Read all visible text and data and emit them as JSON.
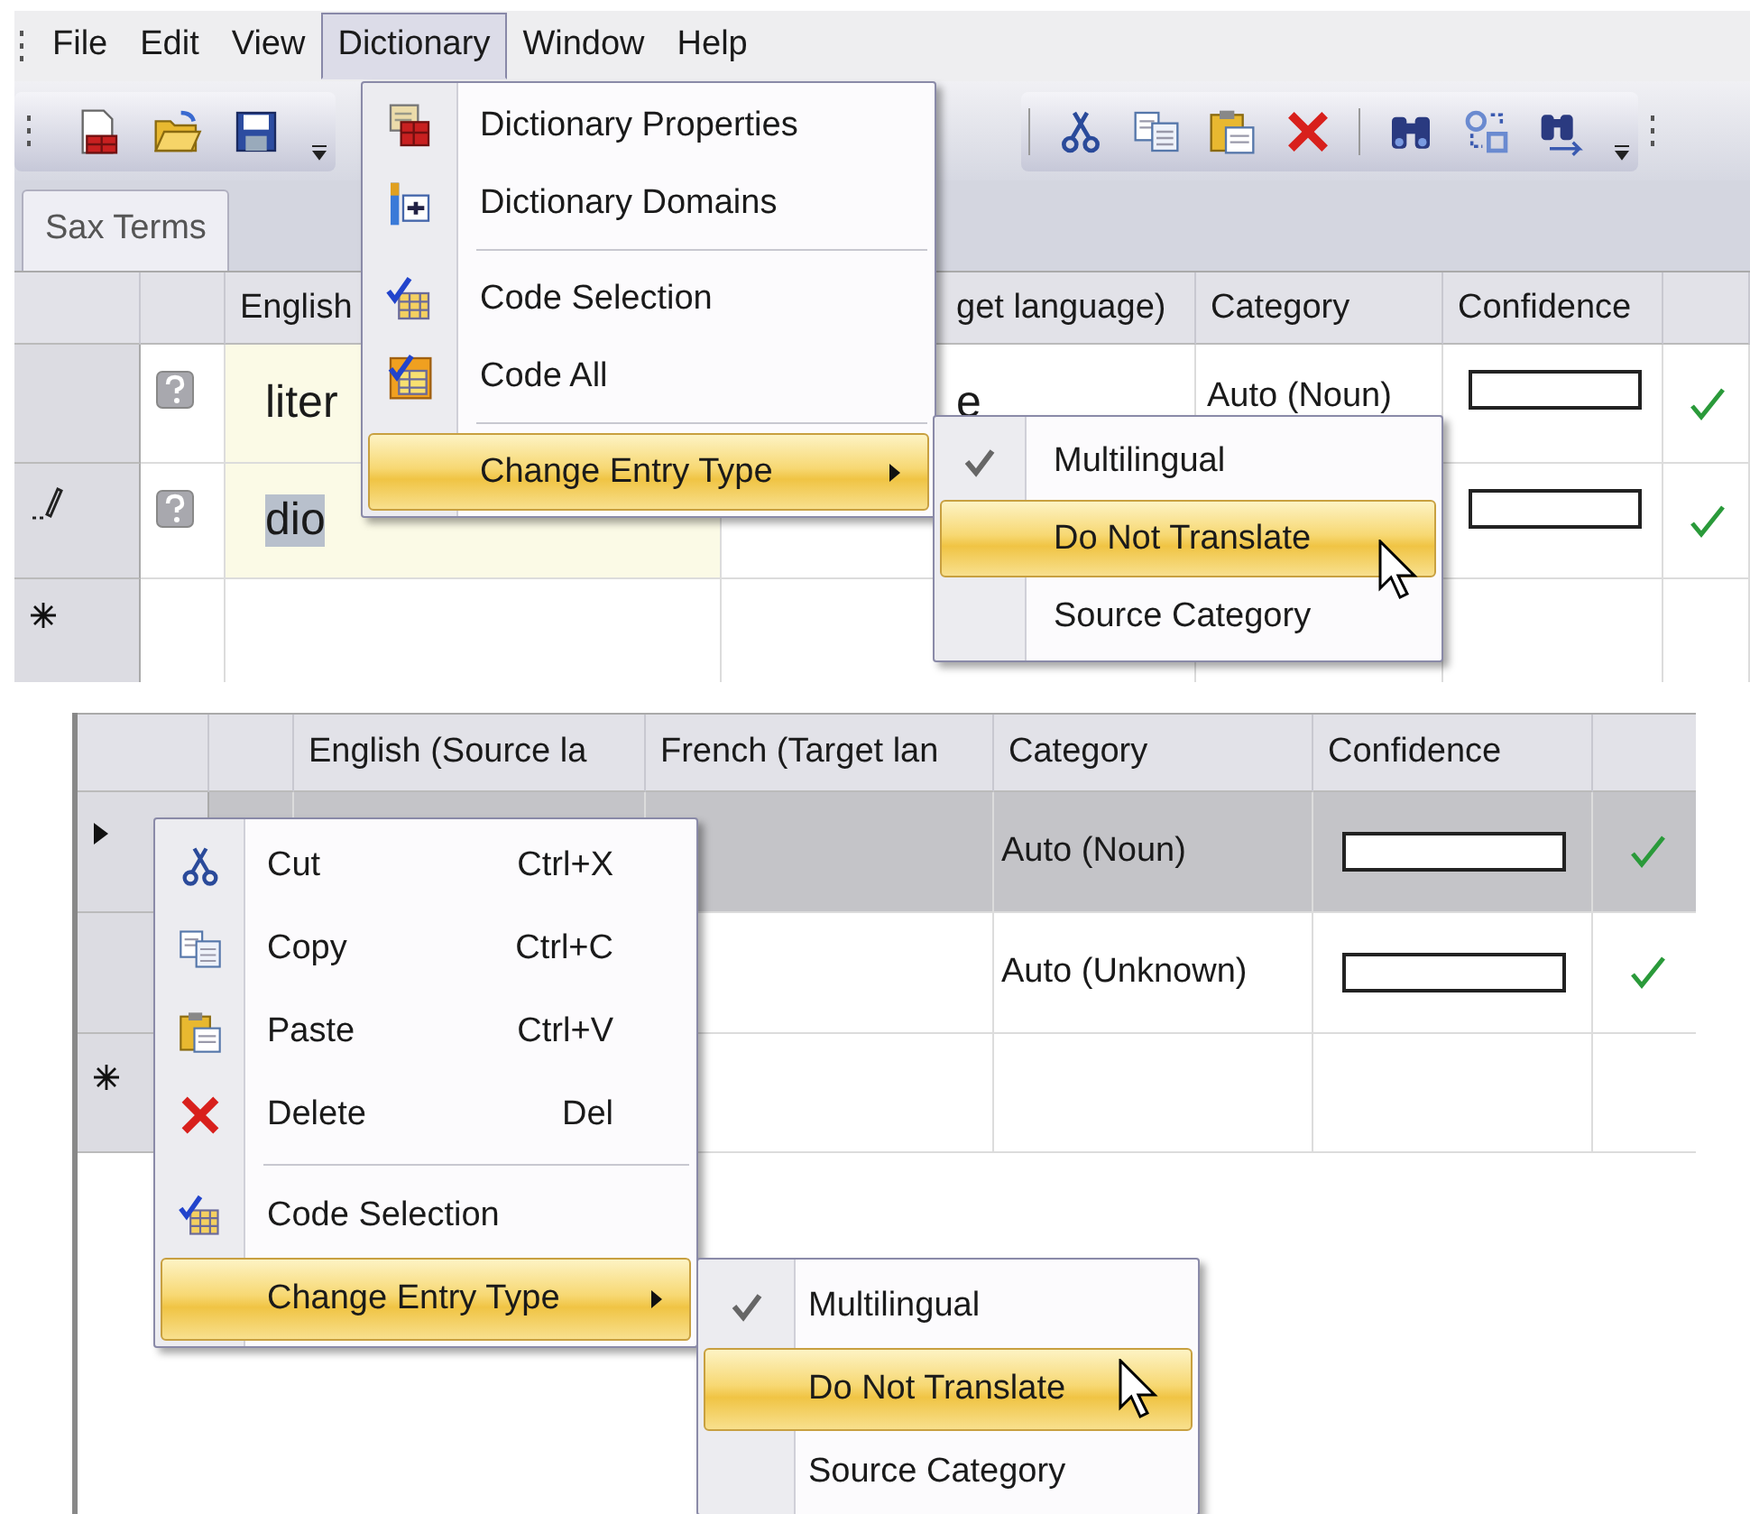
{
  "top_view": {
    "menu_bar": [
      {
        "label": "File",
        "selected": false
      },
      {
        "label": "Edit",
        "selected": false
      },
      {
        "label": "View",
        "selected": false
      },
      {
        "label": "Dictionary",
        "selected": true
      },
      {
        "label": "Window",
        "selected": false
      },
      {
        "label": "Help",
        "selected": false
      }
    ],
    "tabs": [
      {
        "label": "Sax Terms",
        "selected": true
      }
    ],
    "table": {
      "headers": {
        "source": "English",
        "target": "get language)",
        "category": "Category",
        "confidence": "Confidence"
      },
      "rows": [
        {
          "kind": "entry",
          "editing": false,
          "selected": false,
          "source": "liter",
          "source_selected": false,
          "target": "e",
          "category": "Auto (Noun)",
          "level": 0,
          "approved": true
        },
        {
          "kind": "entry",
          "editing": true,
          "selected": false,
          "source": "dio",
          "source_selected": true,
          "level": 0,
          "approved": true
        },
        {
          "kind": "new",
          "editing": false,
          "selected": false
        }
      ]
    },
    "dropdown_menu": {
      "items": [
        {
          "kind": "command",
          "label": "Dictionary Properties",
          "highlighted": false
        },
        {
          "kind": "command",
          "label": "Dictionary Domains",
          "highlighted": false
        },
        {
          "kind": "separator"
        },
        {
          "kind": "command",
          "label": "Code Selection",
          "highlighted": false
        },
        {
          "kind": "command",
          "label": "Code All",
          "highlighted": false
        },
        {
          "kind": "separator"
        },
        {
          "kind": "submenu",
          "label": "Change Entry Type",
          "highlighted": true
        }
      ]
    },
    "submenu": {
      "items": [
        {
          "label": "Multilingual",
          "checked": true,
          "highlighted": false
        },
        {
          "label": "Do Not Translate",
          "checked": false,
          "highlighted": true
        },
        {
          "label": "Source Category",
          "checked": false,
          "highlighted": false
        }
      ]
    }
  },
  "bottom_view": {
    "table": {
      "headers": {
        "source": "English (Source la",
        "target": "French (Target lan",
        "category": "Category",
        "confidence": "Confidence"
      },
      "rows": [
        {
          "kind": "entry",
          "editing": false,
          "selected": true,
          "category": "Auto (Noun)",
          "level": 0,
          "approved": true
        },
        {
          "kind": "entry",
          "editing": false,
          "selected": false,
          "category": "Auto (Unknown)",
          "level": 0,
          "approved": true
        },
        {
          "kind": "new",
          "editing": false,
          "selected": false
        }
      ]
    },
    "context_menu": {
      "items": [
        {
          "kind": "command",
          "label": "Cut",
          "shortcut": "Ctrl+X",
          "highlighted": false
        },
        {
          "kind": "command",
          "label": "Copy",
          "shortcut": "Ctrl+C",
          "highlighted": false
        },
        {
          "kind": "command",
          "label": "Paste",
          "shortcut": "Ctrl+V",
          "highlighted": false
        },
        {
          "kind": "command",
          "label": "Delete",
          "shortcut": "Del",
          "highlighted": false
        },
        {
          "kind": "separator"
        },
        {
          "kind": "command",
          "label": "Code Selection",
          "highlighted": false
        },
        {
          "kind": "submenu",
          "label": "Change Entry Type",
          "highlighted": true
        }
      ]
    },
    "submenu": {
      "items": [
        {
          "label": "Multilingual",
          "checked": true,
          "highlighted": false
        },
        {
          "label": "Do Not Translate",
          "checked": false,
          "highlighted": true
        },
        {
          "label": "Source Category",
          "checked": false,
          "highlighted": false
        }
      ]
    }
  }
}
